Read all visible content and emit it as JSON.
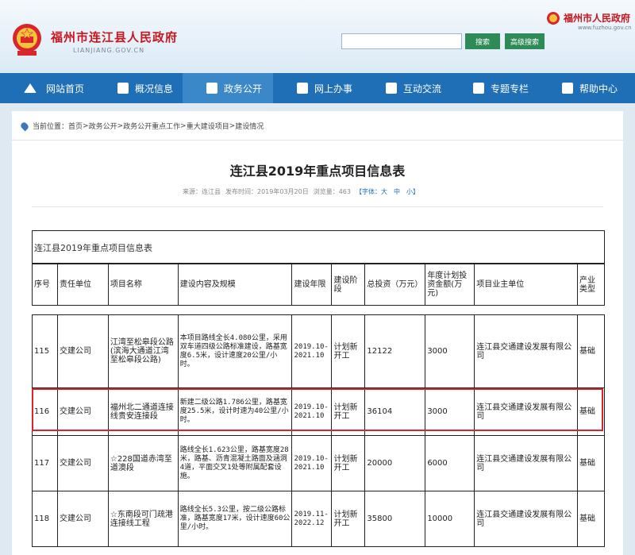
{
  "header": {
    "site_title": "福州市连江县人民政府",
    "site_url": "LIANJIANG.GOV.CN",
    "portal_title": "福州市人民政府",
    "portal_url": "www.fuzhou.gov.cn",
    "search_placeholder": "",
    "search_button": "搜索",
    "advanced_button": "高级搜索"
  },
  "nav": {
    "items": [
      {
        "label": "网站首页",
        "icon": "home-icon"
      },
      {
        "label": "概况信息",
        "icon": "document-icon"
      },
      {
        "label": "政务公开",
        "icon": "book-icon"
      },
      {
        "label": "网上办事",
        "icon": "monitor-icon"
      },
      {
        "label": "互动交流",
        "icon": "chat-icon"
      },
      {
        "label": "专题专栏",
        "icon": "folder-icon"
      },
      {
        "label": "帮助中心",
        "icon": "help-icon"
      }
    ],
    "active_index": 2
  },
  "breadcrumb": {
    "prefix": "当前位置：",
    "path": [
      "首页",
      "政务公开",
      "政务公开重点工作",
      "重大建设项目",
      "建设情况"
    ],
    "separator": " > "
  },
  "article": {
    "title": "连江县2019年重点项目信息表",
    "source": "来源：连江县",
    "published": "发布时间：2019年03月20日",
    "views": "浏览量：463",
    "font_size": "【字体：大　中　小】"
  },
  "table": {
    "caption": "连江县2019年重点项目信息表",
    "headers": [
      "序号",
      "责任单位",
      "项目名称",
      "建设内容及规模",
      "建设年限",
      "建设阶段",
      "总投资（万元）",
      "年度计划投资金额(万元)",
      "项目业主单位",
      "产业类型"
    ],
    "rows": [
      {
        "no": "115",
        "unit": "交建公司",
        "name": "江湾至松皋段公路(滨海大通道江湾至松皋段公路)",
        "scope": "本项目路线全长4.080公里，采用双车道四级公路标准建设，路基宽度6.5米，设计速度20公里/小时。",
        "years": "2019.10-2021.10",
        "stage": "计划新开工",
        "total": "12122",
        "annual": "3000",
        "owner": "连江县交通建设发展有限公司",
        "type": "基础"
      },
      {
        "no": "116",
        "unit": "交建公司",
        "name": "福州北二通道连接线贵安连接段",
        "scope": "新建二级公路1.786公里，路基宽度25.5米，设计时速为40公里/小时。",
        "years": "2019.10-2021.10",
        "stage": "计划新开工",
        "total": "36104",
        "annual": "3000",
        "owner": "连江县交通建设发展有限公司",
        "type": "基础"
      },
      {
        "no": "117",
        "unit": "交建公司",
        "name": "☆228国道赤湾至道澳段",
        "scope": "路线全长1.623公里，路基宽度28米，路基、沥青混凝土路面及涵洞4道，平面交叉1处等附属配套设施。",
        "years": "2019.10-2021.10",
        "stage": "计划新开工",
        "total": "20000",
        "annual": "6000",
        "owner": "连江县交通建设发展有限公司",
        "type": "基础"
      },
      {
        "no": "118",
        "unit": "交建公司",
        "name": "☆东南段可门疏港连接线工程",
        "scope": "路线全长5.3公里，按二级公路标准，路基宽度17米，设计速度60公里/小时。",
        "years": "2019.11-2022.12",
        "stage": "计划新开工",
        "total": "35800",
        "annual": "10000",
        "owner": "连江县交通建设发展有限公司",
        "type": "基础"
      }
    ]
  }
}
